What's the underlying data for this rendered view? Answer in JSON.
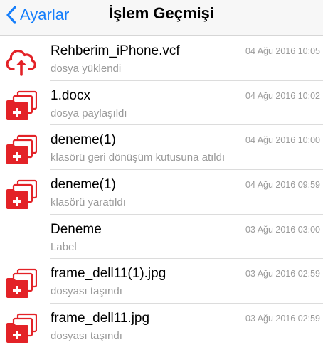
{
  "navbar": {
    "back_label": "Ayarlar",
    "title": "İşlem Geçmişi"
  },
  "colors": {
    "accent": "#157efb",
    "icon_red": "#e32227"
  },
  "items": [
    {
      "icon": "cloud-upload-icon",
      "title": "Rehberim_iPhone.vcf",
      "subtitle": "dosya yüklendi",
      "date": "04 Ağu 2016 10:05"
    },
    {
      "icon": "folder-stack-icon",
      "title": "1.docx",
      "subtitle": "dosya paylaşıldı",
      "date": "04 Ağu 2016 10:02"
    },
    {
      "icon": "folder-stack-icon",
      "title": "deneme(1)",
      "subtitle": "klasörü geri dönüşüm kutusuna atıldı",
      "date": "04 Ağu 2016 10:00"
    },
    {
      "icon": "folder-stack-icon",
      "title": "deneme(1)",
      "subtitle": "klasörü yaratıldı",
      "date": "04 Ağu 2016 09:59"
    },
    {
      "icon": "",
      "title": "Deneme",
      "subtitle": "Label",
      "date": "03 Ağu 2016 03:00"
    },
    {
      "icon": "folder-stack-icon",
      "title": "frame_dell11(1).jpg",
      "subtitle": "dosyası taşındı",
      "date": "03 Ağu 2016 02:59"
    },
    {
      "icon": "folder-stack-icon",
      "title": "frame_dell11.jpg",
      "subtitle": "dosyası taşındı",
      "date": "03 Ağu 2016 02:59"
    }
  ]
}
